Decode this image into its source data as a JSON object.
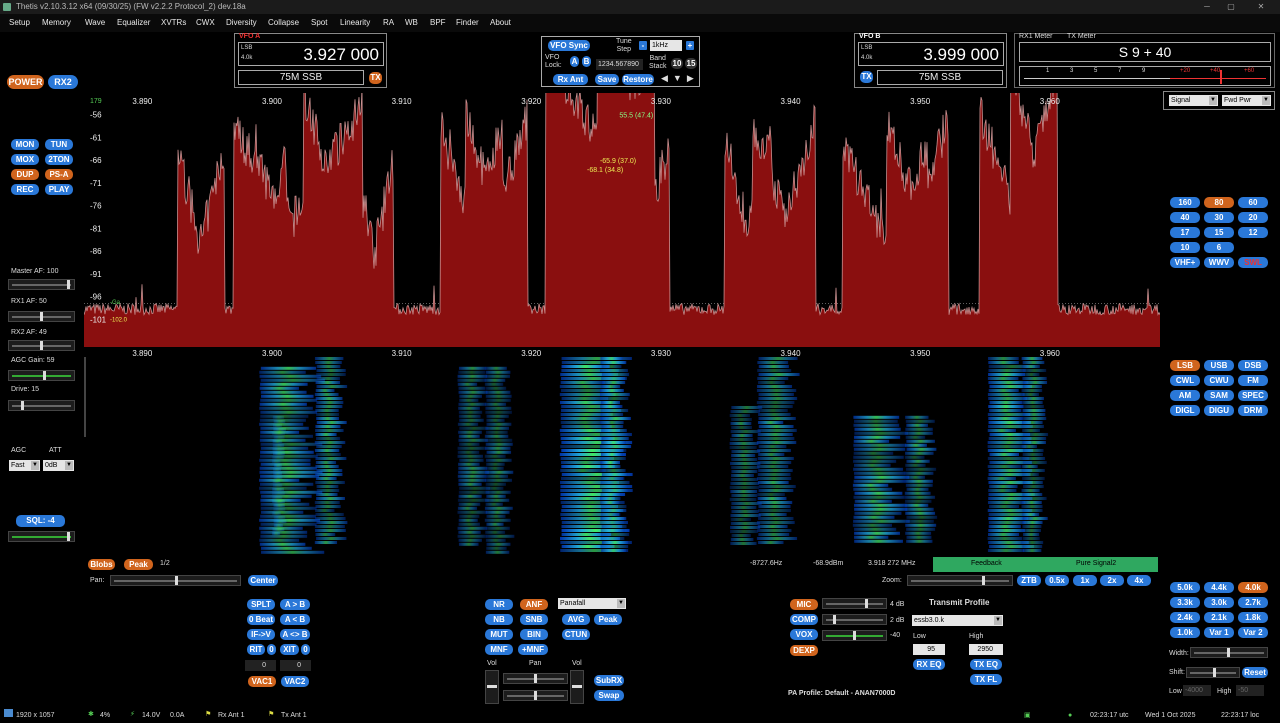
{
  "window": {
    "title": "Thetis v2.10.3.12 x64 (09/30/25) (FW v2.2.2 Protocol_2) dev.18a"
  },
  "menu": [
    "Setup",
    "Memory",
    "Wave",
    "Equalizer",
    "XVTRs",
    "CWX",
    "Diversity",
    "Collapse",
    "Spot",
    "Linearity",
    "RA",
    "WB",
    "BPF",
    "Finder",
    "About"
  ],
  "top_left": {
    "power": "POWER",
    "rx2": "RX2"
  },
  "left_buttons": [
    [
      "MON",
      "TUN"
    ],
    [
      "MOX",
      "2TON"
    ],
    [
      "DUP",
      "PS-A"
    ],
    [
      "REC",
      "PLAY"
    ]
  ],
  "left_controls": {
    "master_af": "Master AF:  100",
    "rx1_af": "RX1 AF:  50",
    "rx2_af": "RX2 AF:  49",
    "agc_gain": "AGC Gain:  59",
    "drive": "Drive:  15",
    "agc": "AGC",
    "att": "ATT",
    "agc_value": "Fast",
    "att_value": "0dB",
    "sql": "SQL: -4"
  },
  "vfo_a": {
    "label": "VFO A",
    "mode": "LSB",
    "bw": "4.0k",
    "freq": "3.927 000",
    "band": "75M SSB",
    "tx": "TX"
  },
  "vfo_sync": {
    "sync": "VFO Sync",
    "tune_step": "Tune\nStep",
    "step": "1kHz",
    "vfo_lock": "VFO\nLock:",
    "a": "A",
    "b": "B",
    "freq_entry": "1234.567890",
    "band_stack": "Band\nStack",
    "n10": "10",
    "n15": "15",
    "rx_ant": "Rx Ant",
    "save": "Save",
    "restore": "Restore"
  },
  "vfo_b": {
    "label": "VFO B",
    "mode": "LSB",
    "bw": "4.0k",
    "freq": "3.999 000",
    "band": "75M SSB",
    "tx": "TX"
  },
  "meter": {
    "rx1": "RX1 Meter",
    "tx": "TX Meter",
    "value": "S 9 + 40",
    "ticks": [
      "1",
      "3",
      "5",
      "7",
      "9",
      "+20",
      "+40",
      "+60"
    ],
    "sel1": "Signal",
    "sel2": "Fwd Pwr"
  },
  "panadapter": {
    "top_value": "179",
    "freq_labels": [
      "3.890",
      "3.900",
      "3.910",
      "3.920",
      "3.930",
      "3.940",
      "3.950",
      "3.960"
    ],
    "db_labels": [
      "-56",
      "-61",
      "-66",
      "-71",
      "-76",
      "-81",
      "-86",
      "-91",
      "-96",
      "-101"
    ],
    "peak1": "55.5 (47.4)",
    "peak2": "-65.9 (37.0)",
    "peak3": "-68.1 (34.8)",
    "marker_a": "-Ga",
    "marker_b": "-102.0"
  },
  "waterfall": {
    "freq_labels": [
      "3.890",
      "3.900",
      "3.910",
      "3.920",
      "3.930",
      "3.940",
      "3.950",
      "3.960"
    ],
    "blobs": "Blobs",
    "peak": "Peak",
    "page": "1/2",
    "readout_hz": "-8727.6Hz",
    "readout_dbm": "-68.9dBm",
    "readout_freq": "3.918 272 MHz",
    "feedback": "Feedback",
    "pure_signal": "Pure Signal2"
  },
  "pan_zoom": {
    "pan": "Pan:",
    "center": "Center",
    "zoom": "Zoom:",
    "ztb": "ZTB",
    "z05": "0.5x",
    "z1": "1x",
    "z2": "2x",
    "z4": "4x"
  },
  "bands": [
    [
      "160",
      "80",
      "60"
    ],
    [
      "40",
      "30",
      "20"
    ],
    [
      "17",
      "15",
      "12"
    ],
    [
      "10",
      "6",
      ""
    ],
    [
      "VHF+",
      "WWV",
      "SWL"
    ]
  ],
  "modes": [
    [
      "LSB",
      "USB",
      "DSB"
    ],
    [
      "CWL",
      "CWU",
      "FM"
    ],
    [
      "AM",
      "SAM",
      "SPEC"
    ],
    [
      "DIGL",
      "DIGU",
      "DRM"
    ]
  ],
  "filters": [
    [
      "5.0k",
      "4.4k",
      "4.0k"
    ],
    [
      "3.3k",
      "3.0k",
      "2.7k"
    ],
    [
      "2.4k",
      "2.1k",
      "1.8k"
    ],
    [
      "1.0k",
      "Var 1",
      "Var 2"
    ]
  ],
  "filter_controls": {
    "width": "Width:",
    "shift": "Shift:",
    "reset": "Reset",
    "low": "Low",
    "high": "High",
    "low_val": "-4000",
    "high_val": "-50"
  },
  "split_group": {
    "split": "SPLT",
    "atob": "A > B",
    "zerobeat": "0 Beat",
    "btoa": "A < B",
    "ifv": "IF->V",
    "swap": "A <> B",
    "rit": "RIT",
    "rit_val": "0",
    "xit": "XIT",
    "xit_val": "0",
    "rit_num": "0",
    "xit_num": "0",
    "vac1": "VAC1",
    "vac2": "VAC2"
  },
  "dsp_group": {
    "nr": "NR",
    "anf": "ANF",
    "nb": "NB",
    "snb": "SNB",
    "mut": "MUT",
    "bin": "BIN",
    "mnf": "MNF",
    "plus_mnf": "+MNF",
    "display": "Panafall",
    "avg": "AVG",
    "peak": "Peak",
    "ctun": "CTUN",
    "vol": "Vol",
    "pan": "Pan",
    "vol2": "Vol",
    "subrx": "SubRX",
    "swap": "Swap"
  },
  "tx_group": {
    "mic": "MIC",
    "comp": "COMP",
    "vox": "VOX",
    "dexp": "DEXP",
    "mic_db": "4 dB",
    "comp_db": "2 dB",
    "vox_db": "-40",
    "profile_title": "Transmit Profile",
    "profile": "essb3.0.k",
    "low": "Low",
    "high": "High",
    "low_val": "95",
    "high_val": "2950",
    "rx_eq": "RX EQ",
    "tx_eq": "TX EQ",
    "tx_fl": "TX FL",
    "pa_profile": "PA Profile: Default - ANAN7000D"
  },
  "status": {
    "resolution": "1920 x 1057",
    "cpu": "4%",
    "volts": "14.0V",
    "amps": "0.0A",
    "rx_ant": "Rx Ant 1",
    "tx_ant": "Tx Ant 1",
    "utc": "02:23:17 utc",
    "date": "Wed 1 Oct 2025",
    "loc": "22:23:17 loc"
  },
  "colors": {
    "accent_blue": "#2a78d8",
    "active_orange": "#d0641d",
    "spectrum_fill": "#8a0f0f",
    "feedback_green": "#2fa860"
  }
}
